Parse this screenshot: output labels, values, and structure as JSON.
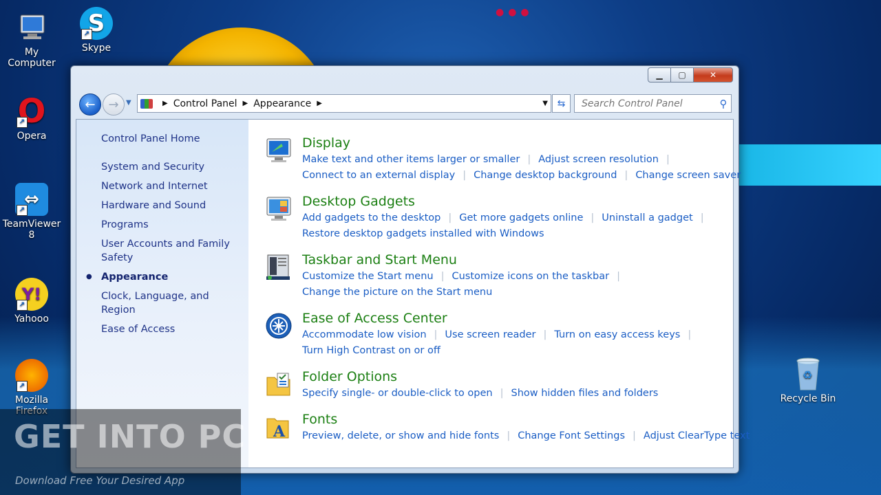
{
  "desktop": {
    "icons": [
      {
        "label": "My Computer"
      },
      {
        "label": "Skype"
      },
      {
        "label": "Opera"
      },
      {
        "label": "TeamViewer 8"
      },
      {
        "label": "Yahooo"
      },
      {
        "label": "Mozilla Firefox"
      },
      {
        "label": "Recycle Bin"
      }
    ]
  },
  "window": {
    "controls": {
      "minimize": "▁",
      "maximize": "▢",
      "close": "✕"
    }
  },
  "address": {
    "crumbs": [
      "Control Panel",
      "Appearance"
    ]
  },
  "search": {
    "placeholder": "Search Control Panel"
  },
  "sidebar": {
    "home": "Control Panel Home",
    "items": [
      "System and Security",
      "Network and Internet",
      "Hardware and Sound",
      "Programs",
      "User Accounts and Family Safety",
      "Appearance",
      "Clock, Language, and Region",
      "Ease of Access"
    ],
    "current_index": 5
  },
  "categories": [
    {
      "title": "Display",
      "icon": "display-icon",
      "links": [
        "Make text and other items larger or smaller",
        "Adjust screen resolution",
        "Connect to an external display",
        "Change desktop background",
        "Change screen saver"
      ]
    },
    {
      "title": "Desktop Gadgets",
      "icon": "gadgets-icon",
      "links": [
        "Add gadgets to the desktop",
        "Get more gadgets online",
        "Uninstall a gadget",
        "Restore desktop gadgets installed with Windows"
      ]
    },
    {
      "title": "Taskbar and Start Menu",
      "icon": "taskbar-icon",
      "links": [
        "Customize the Start menu",
        "Customize icons on the taskbar",
        "Change the picture on the Start menu"
      ]
    },
    {
      "title": "Ease of Access Center",
      "icon": "ease-of-access-icon",
      "links": [
        "Accommodate low vision",
        "Use screen reader",
        "Turn on easy access keys",
        "Turn High Contrast on or off"
      ]
    },
    {
      "title": "Folder Options",
      "icon": "folder-options-icon",
      "links": [
        "Specify single- or double-click to open",
        "Show hidden files and folders"
      ]
    },
    {
      "title": "Fonts",
      "icon": "fonts-icon",
      "links": [
        "Preview, delete, or show and hide fonts",
        "Change Font Settings",
        "Adjust ClearType text"
      ]
    }
  ],
  "watermark": {
    "title": "GET INTO PC",
    "subtitle": "Download Free Your Desired App"
  },
  "colors": {
    "link": "#1a5dc4",
    "category_title": "#1b7f12",
    "sidebar_link": "#1e3287"
  }
}
